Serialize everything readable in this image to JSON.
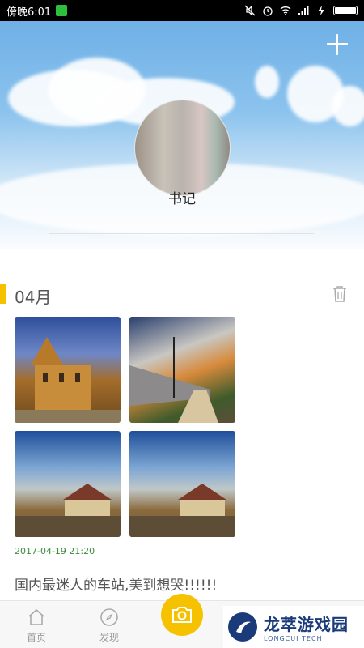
{
  "status_bar": {
    "time": "傍晚6:01",
    "icons": [
      "notification-app-icon",
      "mute-icon",
      "alarm-icon",
      "wifi-icon",
      "signal-icon",
      "charging-icon",
      "battery-icon"
    ]
  },
  "header": {
    "add_icon": "plus-icon",
    "username": "书记"
  },
  "section": {
    "month": "04月",
    "accent_color": "#f6c200",
    "delete_icon": "trash-icon"
  },
  "post": {
    "date": "2017-04-19 21:20",
    "text": "国内最迷人的车站,美到想哭!!!!!!"
  },
  "bottom_nav": {
    "home_label": "首页",
    "discover_label": "发现",
    "camera_icon": "camera-icon"
  },
  "watermark": {
    "main": "龙萃游戏园",
    "sub": "LONGCUI TECH"
  }
}
